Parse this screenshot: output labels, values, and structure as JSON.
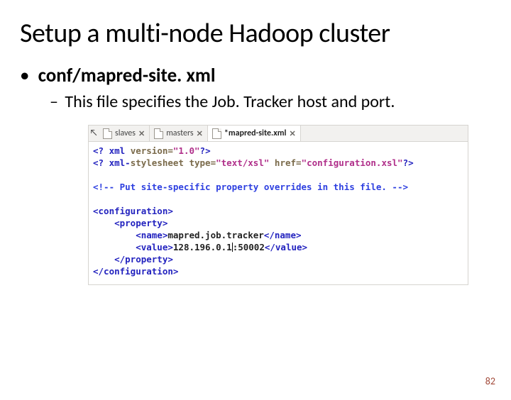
{
  "title": "Setup a multi-node Hadoop cluster",
  "bullet1": "conf/mapred-site. xml",
  "bullet2": "This file specifies the Job. Tracker host and port.",
  "tabs": {
    "t0": {
      "label": "slaves",
      "close": "✕"
    },
    "t1": {
      "label": "masters",
      "close": "✕"
    },
    "t2": {
      "label": "*mapred-site.xml",
      "close": "✕"
    }
  },
  "code": {
    "l1a": "<? xml ",
    "l1b": "version=",
    "l1c": "\"1.0\"",
    "l1d": "?>",
    "l2a": "<? xml-",
    "l2b": "stylesheet ",
    "l2c": "type=",
    "l2d": "\"text/xsl\" ",
    "l2e": "href=",
    "l2f": "\"configuration.xsl\"",
    "l2g": "?>",
    "l3": "<!-- Put site-specific property overrides in this file. -->",
    "l4": "<configuration>",
    "l5": "    <property>",
    "l6a": "        <name>",
    "l6b": "mapred.job.tracker",
    "l6c": "</name>",
    "l7a": "        <value>",
    "l7b": "128.196.0.1",
    "l7c": ":50002",
    "l7d": "</value>",
    "l8": "    </property>",
    "l9": "</configuration>"
  },
  "pageNumber": "82"
}
